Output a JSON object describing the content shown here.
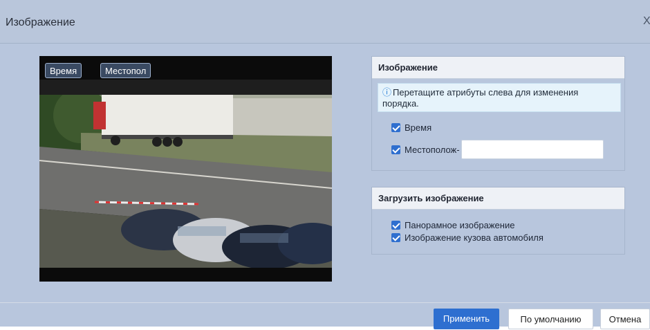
{
  "dialog": {
    "title": "Изображение",
    "close_glyph": "X"
  },
  "preview": {
    "overlay_time": "Время",
    "overlay_location": "Местопол"
  },
  "image_panel": {
    "title": "Изображение",
    "hint": "Перетащите атрибуты слева для изменения порядка.",
    "items": [
      {
        "label": "Время",
        "checked": true
      },
      {
        "label": "Местополож-",
        "checked": true,
        "input_value": ""
      }
    ]
  },
  "upload_panel": {
    "title": "Загрузить изображение",
    "items": [
      {
        "label": "Панорамное изображение",
        "checked": true
      },
      {
        "label": "Изображение кузова автомобиля",
        "checked": true
      }
    ]
  },
  "footer": {
    "apply": "Применить",
    "default": "По умолчанию",
    "cancel": "Отмена"
  },
  "colors": {
    "background": "#b8c6dd",
    "primary": "#2e6fd0",
    "checkbox": "#2f6fcf",
    "info_bg": "#e6f3fb"
  },
  "icons": [
    "info-icon",
    "checkbox-checked-icon",
    "close-icon"
  ]
}
